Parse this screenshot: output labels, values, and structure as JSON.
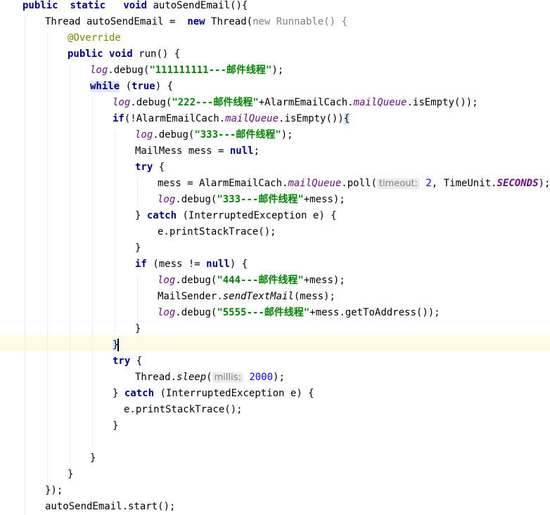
{
  "code": {
    "l0_mod": "public",
    "l0_static": "static",
    "l0_void": "void",
    "l0_sig": "autoSendEmail(){",
    "l1_decl": "Thread autoSendEmail = ",
    "l1_new": "new",
    "l1_thread": "Thread(",
    "l1_new2": "new",
    "l1_runnable": "Runnable() {",
    "l1_end": "",
    "l2_ann": "@Override",
    "l3_public": "public",
    "l3_void": "void",
    "l3_run": "run() {",
    "log": "log",
    "debug_open": ".debug(",
    "str_1": "\"111111111---邮件线程\"",
    "close_semi": ");",
    "l5_while": "while",
    "l5_open": " (",
    "l5_true": "true",
    "l5_close": ") {",
    "str_2": "\"222---邮件线程\"",
    "plus_cache": "+AlarmEmailCach.",
    "mail_queue": "mailQueue",
    "is_empty_close": ".isEmpty());",
    "l7_if": "if",
    "l7_cond": "(!AlarmEmailCach.",
    "l7_is_empty": ".isEmpty())",
    "brace_open": "{",
    "str_3": "\"333---邮件线程\"",
    "l9_decl": "MailMess mess = ",
    "null_kw": "null",
    "semi": ";",
    "try_kw": "try",
    "space_brace": " {",
    "l11_assign": "mess = AlarmEmailCach.",
    "poll_open": ".poll(",
    "hint_timeout": "timeout:",
    "num_2": "2",
    "timeunit": ", TimeUnit.",
    "seconds": "SECONDS",
    "plus_mess": "+mess);",
    "close_brace": "}",
    "catch_kw": "catch",
    "catch_sig": " (InterruptedException e) {",
    "print_stack": "e.printStackTrace();",
    "if_kw": "if",
    "l15_cond": " (mess != ",
    "l15_close": ") {",
    "str_4": "\"444---邮件线程\"",
    "l17_sender": "MailSender.",
    "send_text_mail": "sendTextMail",
    "l17_args": "(mess);",
    "str_5": "\"5555---邮件线程\"",
    "l18_tail": "+mess.getToAddress());",
    "thread_sleep": "Thread.",
    "sleep_kw": "sleep",
    "paren_open": "(",
    "hint_millis": "millis:",
    "num_2000": "2000",
    "close_paren_semi": ");",
    "l28_end": "});",
    "l29_start": "autoSendEmail.start();"
  }
}
